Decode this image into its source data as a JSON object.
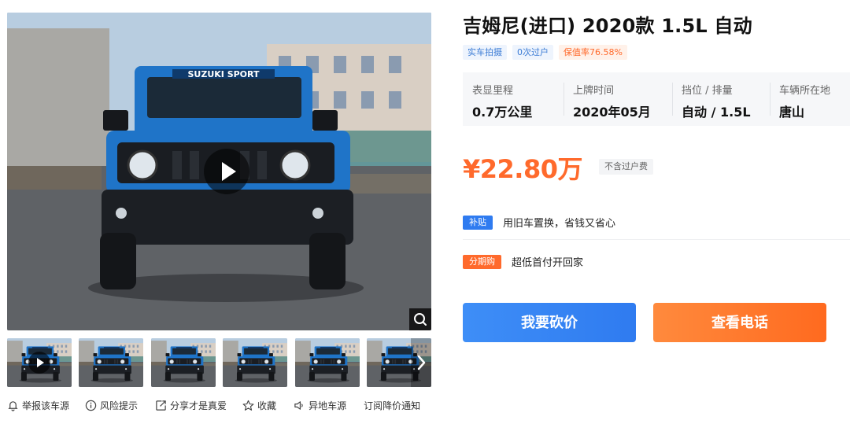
{
  "listing": {
    "title": "吉姆尼(进口) 2020款 1.5L 自动",
    "tags": [
      {
        "label": "实车拍摄",
        "tone": "blue"
      },
      {
        "label": "0次过户",
        "tone": "blue"
      },
      {
        "label": "保值率76.58%",
        "tone": "orange"
      }
    ],
    "specs": [
      {
        "label": "表显里程",
        "value": "0.7万公里"
      },
      {
        "label": "上牌时间",
        "value": "2020年05月"
      },
      {
        "label": "挡位 / 排量",
        "value": "自动 / 1.5L"
      },
      {
        "label": "车辆所在地",
        "value": "唐山"
      }
    ],
    "price": "¥22.80万",
    "price_note": "不含过户费",
    "promos": [
      {
        "badge": "补贴",
        "badge_color": "#2f7bf0",
        "text": "用旧车置换，省钱又省心"
      },
      {
        "badge": "分期购",
        "badge_color": "#ff6a2c",
        "text": "超低首付开回家"
      }
    ]
  },
  "buttons": {
    "bargain": "我要砍价",
    "phone": "查看电话"
  },
  "media": {
    "brand_text": "SUZUKI SPORT",
    "thumbnail_count": 6,
    "actions": [
      {
        "label": "举报该车源",
        "icon": "bell-icon"
      },
      {
        "label": "风险提示",
        "icon": "info-icon"
      },
      {
        "label": "分享才是真爱",
        "icon": "share-icon"
      },
      {
        "label": "收藏",
        "icon": "star-icon"
      },
      {
        "label": "异地车源",
        "icon": "speaker-icon"
      },
      {
        "label": "订阅降价通知",
        "icon": ""
      }
    ]
  },
  "colors": {
    "accent_orange": "#ff6a2c",
    "accent_blue": "#2f7bf0",
    "car_blue": "#1f74c8"
  }
}
